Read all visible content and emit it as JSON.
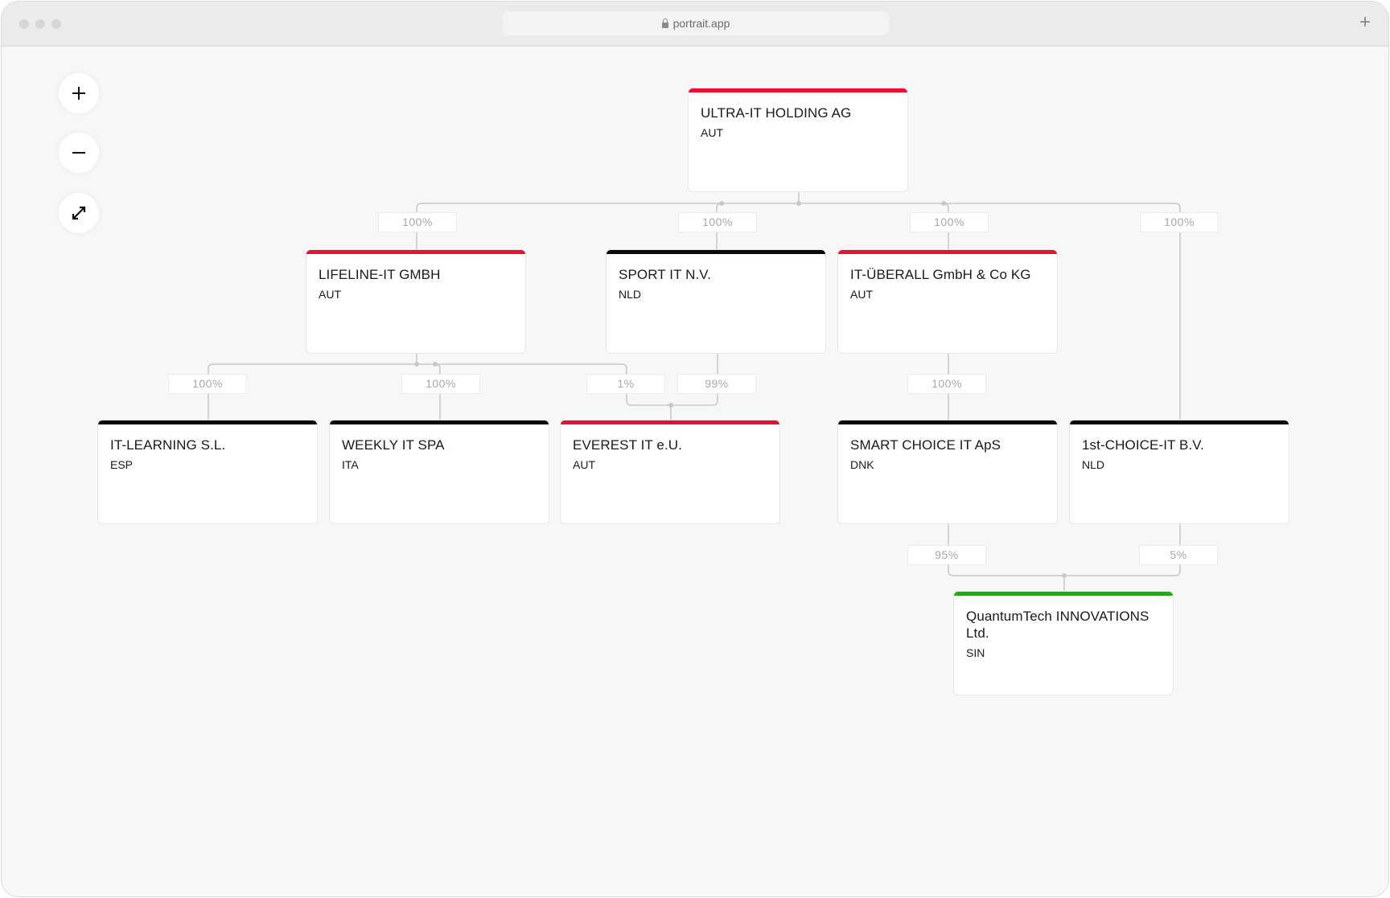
{
  "browser": {
    "url": "portrait.app",
    "new_tab_label": "+"
  },
  "controls": {
    "zoom_in": "+",
    "zoom_out": "−",
    "fit_icon": "expand-arrows"
  },
  "colors": {
    "red": "#e8102e",
    "black": "#0a0a0a",
    "green": "#2aa31f"
  },
  "entities": [
    {
      "id": "ultra",
      "name": "ULTRA-IT HOLDING AG",
      "country": "AUT",
      "status_color": "red"
    },
    {
      "id": "lifeline",
      "name": "LIFELINE-IT GMBH",
      "country": "AUT",
      "status_color": "red"
    },
    {
      "id": "sport",
      "name": "SPORT IT N.V.",
      "country": "NLD",
      "status_color": "black"
    },
    {
      "id": "ueberall",
      "name": "IT-ÜBERALL GmbH & Co KG",
      "country": "AUT",
      "status_color": "red"
    },
    {
      "id": "itlearning",
      "name": "IT-LEARNING S.L.",
      "country": "ESP",
      "status_color": "black"
    },
    {
      "id": "weekly",
      "name": "WEEKLY IT SPA",
      "country": "ITA",
      "status_color": "black"
    },
    {
      "id": "everest",
      "name": "EVEREST IT e.U.",
      "country": "AUT",
      "status_color": "red"
    },
    {
      "id": "smart",
      "name": "SMART CHOICE IT ApS",
      "country": "DNK",
      "status_color": "black"
    },
    {
      "id": "firstchoice",
      "name": "1st-CHOICE-IT B.V.",
      "country": "NLD",
      "status_color": "black"
    },
    {
      "id": "quantum",
      "name": "QuantumTech INNOVATIONS Ltd.",
      "country": "SIN",
      "status_color": "green"
    }
  ],
  "ownerships": [
    {
      "from": "ultra",
      "to": "lifeline",
      "share": "100%"
    },
    {
      "from": "ultra",
      "to": "sport",
      "share": "100%"
    },
    {
      "from": "ultra",
      "to": "ueberall",
      "share": "100%"
    },
    {
      "from": "ultra",
      "to": "firstchoice",
      "share": "100%"
    },
    {
      "from": "lifeline",
      "to": "itlearning",
      "share": "100%"
    },
    {
      "from": "lifeline",
      "to": "weekly",
      "share": "100%"
    },
    {
      "from": "lifeline",
      "to": "everest",
      "share": "1%"
    },
    {
      "from": "sport",
      "to": "everest",
      "share": "99%"
    },
    {
      "from": "ueberall",
      "to": "smart",
      "share": "100%"
    },
    {
      "from": "smart",
      "to": "quantum",
      "share": "95%"
    },
    {
      "from": "firstchoice",
      "to": "quantum",
      "share": "5%"
    }
  ]
}
